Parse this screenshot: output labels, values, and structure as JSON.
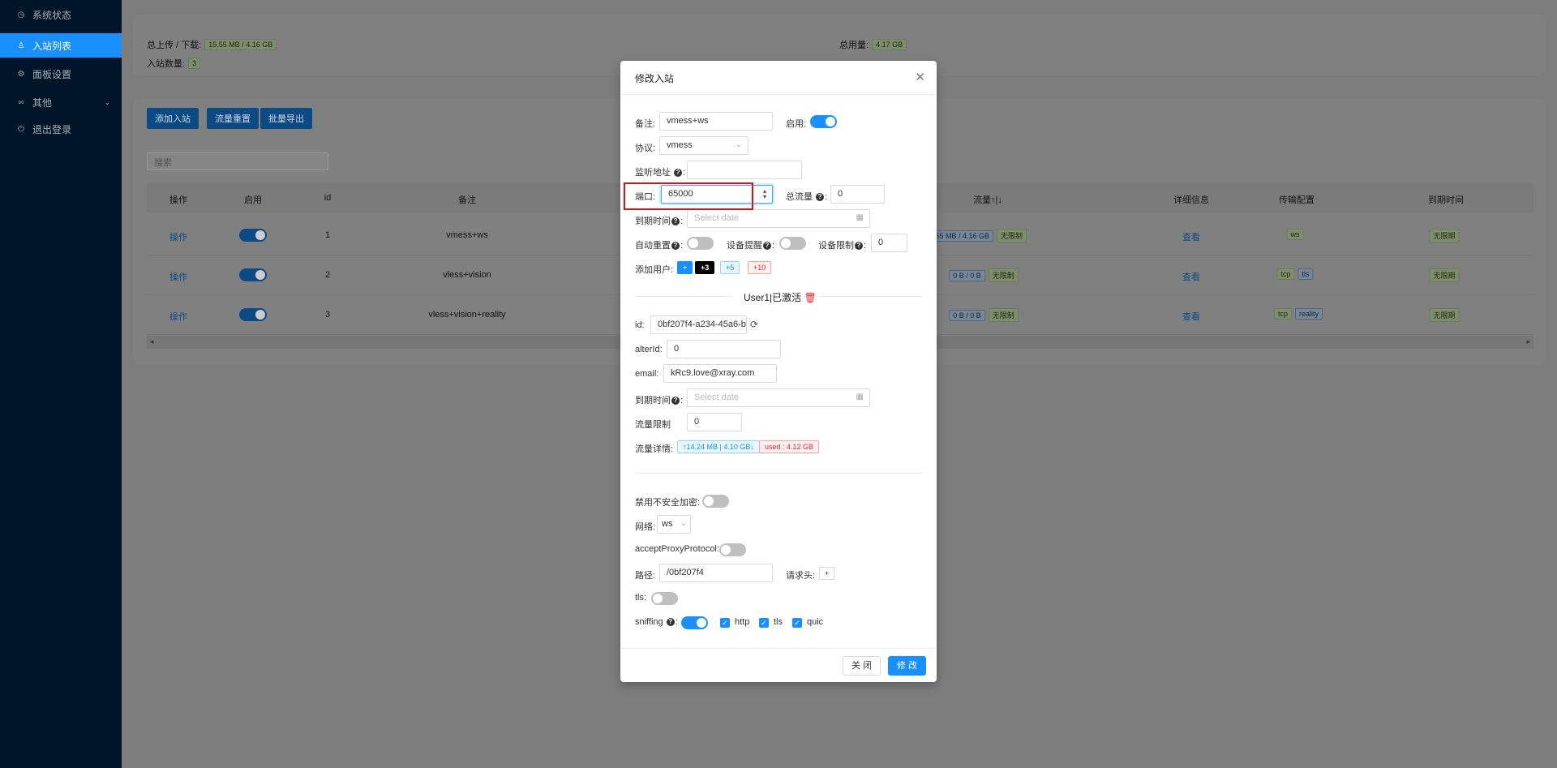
{
  "sidebar": {
    "items": [
      {
        "label": "系统状态",
        "icon": "dashboard-icon"
      },
      {
        "label": "入站列表",
        "icon": "user-icon"
      },
      {
        "label": "面板设置",
        "icon": "gear-icon"
      },
      {
        "label": "其他",
        "icon": "link-icon"
      },
      {
        "label": "退出登录",
        "icon": "logout-icon"
      }
    ]
  },
  "summary": {
    "traffic_label": "总上传 / 下载:",
    "traffic_value": "15.55 MB / 4.16 GB",
    "total_label": "总用量:",
    "total_value": "4.17 GB",
    "count_label": "入站数量:",
    "count_value": "3"
  },
  "toolbar": {
    "add": "添加入站",
    "reset": "流量重置",
    "export": "批量导出",
    "search_placeholder": "搜索"
  },
  "table": {
    "headers": {
      "op": "操作",
      "enable": "启用",
      "id": "id",
      "remark": "备注",
      "traffic": "流量↑|↓",
      "detail": "详细信息",
      "transport": "传输配置",
      "expiry": "到期时间"
    },
    "rows": [
      {
        "op": "操作",
        "id": "1",
        "remark": "vmess+ws",
        "traffic": "15.55 MB / 4.16 GB",
        "limit": "无限制",
        "detail": "查看",
        "transport": [
          "ws"
        ],
        "expiry": "无限期"
      },
      {
        "op": "操作",
        "id": "2",
        "remark": "vless+vision",
        "traffic": "0 B / 0 B",
        "limit": "无限制",
        "detail": "查看",
        "transport": [
          "tcp",
          "tls"
        ],
        "expiry": "无限期"
      },
      {
        "op": "操作",
        "id": "3",
        "remark": "vless+vision+reality",
        "traffic": "0 B / 0 B",
        "limit": "无限制",
        "detail": "查看",
        "transport": [
          "tcp",
          "reality"
        ],
        "expiry": "无限期"
      }
    ]
  },
  "modal": {
    "title": "修改入站",
    "remark_label": "备注:",
    "remark_value": "vmess+ws",
    "enable_label": "启用:",
    "protocol_label": "协议:",
    "protocol_value": "vmess",
    "listen_label": "监听地址",
    "port_label": "端口:",
    "port_value": "65000",
    "total_traffic_label": "总流量",
    "total_traffic_value": "0",
    "expiry_label": "到期时间",
    "date_placeholder": "Select date",
    "auto_reset_label": "自动重置",
    "device_alert_label": "设备提醒",
    "device_limit_label": "设备限制",
    "device_limit_value": "0",
    "add_user_label": "添加用户:",
    "add_plus": "+",
    "add_3": "+3",
    "add_5": "+5",
    "add_10": "+10",
    "user_title": "User1|已激活",
    "id_label": "id:",
    "id_value": "0bf207f4-a234-45a6-b",
    "alterid_label": "alterId:",
    "alterid_value": "0",
    "email_label": "email:",
    "email_value": "kRc9.love@xray.com",
    "user_expiry_label": "到期时间",
    "traffic_limit_label": "流量限制",
    "traffic_limit_value": "0",
    "traffic_detail_label": "流量详情:",
    "traffic_detail_value": "↑14.24 MB | 4.10 GB↓",
    "used_value": "used : 4.12 GB",
    "disable_insecure_label": "禁用不安全加密:",
    "network_label": "网络:",
    "network_value": "ws",
    "accept_proxy_label": "acceptProxyProtocol:",
    "path_label": "路径:",
    "path_value": "/0bf207f4",
    "header_label": "请求头:",
    "header_add": "+",
    "tls_label": "tls:",
    "sniffing_label": "sniffing",
    "sniff_http": "http",
    "sniff_tls": "tls",
    "sniff_quic": "quic",
    "close_btn": "关 闭",
    "ok_btn": "修 改"
  }
}
